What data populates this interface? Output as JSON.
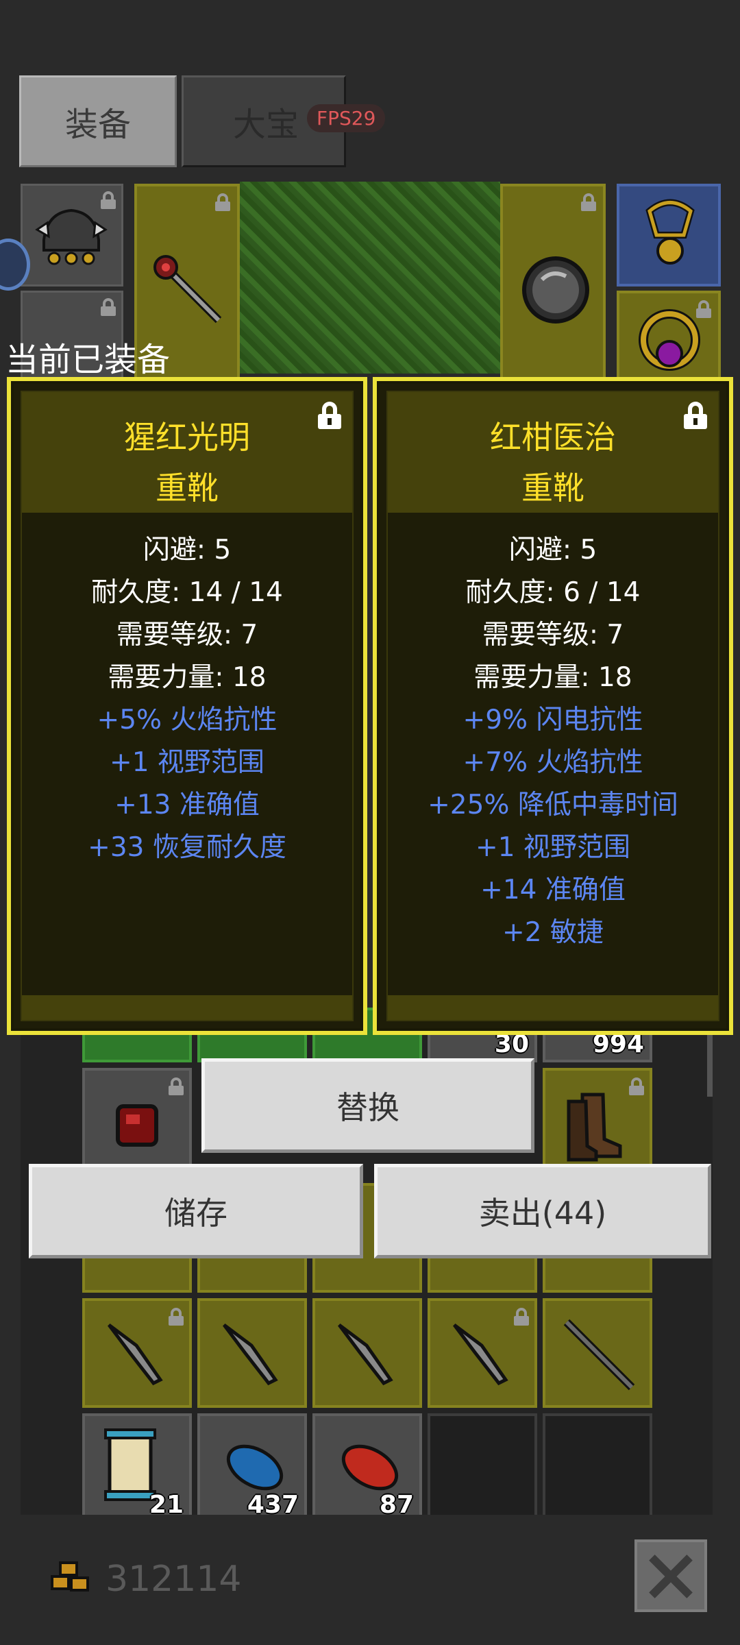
{
  "tabs": [
    {
      "label": "装备",
      "active": true
    },
    {
      "label": "大宝",
      "active": false
    }
  ],
  "fps_badge": "FPS29",
  "equipped_label": "当前已装备",
  "cards": [
    {
      "name": "猩红光明",
      "type": "重靴",
      "stats": [
        "闪避: 5",
        "耐久度: 14 / 14",
        "需要等级: 7",
        "需要力量: 18"
      ],
      "bonuses": [
        "+5% 火焰抗性",
        "+1 视野范围",
        "+13 准确值",
        "+33 恢复耐久度"
      ]
    },
    {
      "name": "红柑医治",
      "type": "重靴",
      "stats": [
        "闪避: 5",
        "耐久度: 6 / 14",
        "需要等级: 7",
        "需要力量: 18"
      ],
      "bonuses": [
        "+9% 闪电抗性",
        "+7% 火焰抗性",
        "+25% 降低中毒时间",
        "+1 视野范围",
        "+14 准确值",
        "+2 敏捷"
      ]
    }
  ],
  "buttons": {
    "replace": "替换",
    "store": "储存",
    "sell": "卖出(44)"
  },
  "inventory": {
    "partial_counts": [
      "30",
      "994"
    ],
    "bottom_counts": [
      "21",
      "437",
      "87"
    ]
  },
  "gold": "312114",
  "colors": {
    "card_border": "#ebe23a",
    "item_name": "#ffe02a",
    "bonus_text": "#5c86f2"
  }
}
